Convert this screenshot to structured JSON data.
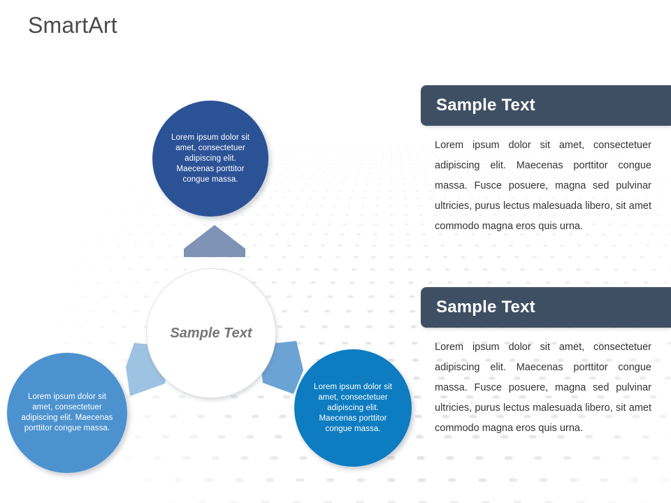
{
  "page": {
    "title": "SmartArt",
    "background_color": "#ffffff"
  },
  "diagram": {
    "center": {
      "label": "Sample Text",
      "color": "#ffffff",
      "text_color": "#767676"
    },
    "nodes": [
      {
        "id": "node-top",
        "position": "top",
        "text": "Lorem ipsum dolor sit amet, consectetuer adipiscing elit. Maecenas porttitor congue massa.",
        "color": "#2c5296",
        "text_color": "#ffffff"
      },
      {
        "id": "node-bottom-left",
        "position": "bottom-left",
        "text": "Lorem ipsum dolor sit amet, consectetuer adipiscing elit. Maecenas porttitor congue massa.",
        "color": "#4c92cf",
        "text_color": "#ffffff"
      },
      {
        "id": "node-bottom-right",
        "position": "bottom-right",
        "text": "Lorem ipsum dolor sit amet, consectetuer adipiscing elit. Maecenas porttitor congue massa.",
        "color": "#0d7cc0",
        "text_color": "#ffffff"
      }
    ],
    "arrows": [
      {
        "id": "arrow-up",
        "direction": "up",
        "color": "#7e93b5"
      },
      {
        "id": "arrow-down-left",
        "direction": "down-left",
        "color": "#9dc2e2"
      },
      {
        "id": "arrow-down-right",
        "direction": "down-right",
        "color": "#6ba4d4"
      }
    ]
  },
  "panels": [
    {
      "id": "panel-1",
      "header": "Sample Text",
      "header_color": "#3f4f63",
      "body": "Lorem ipsum dolor sit amet, consectetuer adipiscing elit. Maecenas porttitor congue massa. Fusce posuere, magna sed pulvinar ultricies, purus lectus malesuada libero, sit amet commodo magna eros quis urna."
    },
    {
      "id": "panel-2",
      "header": "Sample Text",
      "header_color": "#3f4f63",
      "body": "Lorem ipsum dolor sit amet, consectetuer adipiscing elit. Maecenas porttitor congue massa. Fusce posuere, magna sed pulvinar ultricies, purus lectus malesuada libero, sit amet commodo magna eros quis urna."
    }
  ]
}
